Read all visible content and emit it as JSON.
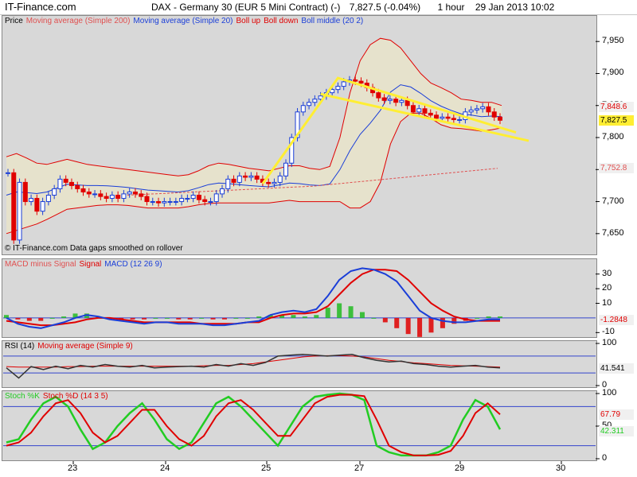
{
  "header": {
    "brand": "IT-Finance.com",
    "instrument": "DAX - Germany 30 (EUR 5 Mini Contract) (-)",
    "last": "7,827.5 (-0.04%)",
    "timeframe": "1 hour",
    "datetime": "29 Jan 2013 10:02"
  },
  "colors": {
    "background": "#d8d8d8",
    "ma200": "#e05050",
    "ma20": "#1a3ed8",
    "boll": "#e00000",
    "bollFill": "#e6e2cc",
    "bullCandle": "#1a3ed8",
    "bearCandle": "#e00000",
    "trendline": "#ffee33",
    "macdLine": "#1a3ed8",
    "signalLine": "#e00000",
    "histPos": "#22bb22",
    "histNeg": "#e00000",
    "rsi": "#333333",
    "rsiMa": "#e00000",
    "stochK": "#22cc22",
    "stochD": "#e00000"
  },
  "footnote": "© IT-Finance.com  Data gaps smoothed on rollover",
  "chart_data": [
    {
      "type": "candlestick",
      "panel": "price",
      "legend": [
        {
          "text": "Price",
          "color": "#000000"
        },
        {
          "text": "Moving average (Simple 200)",
          "color": "#e05050"
        },
        {
          "text": "Moving average (Simple 20)",
          "color": "#1a3ed8"
        },
        {
          "text": "Boll up",
          "color": "#e00000"
        },
        {
          "text": "Boll down",
          "color": "#e00000"
        },
        {
          "text": "Boll middle (20 2)",
          "color": "#1a3ed8"
        }
      ],
      "ylim": [
        7620,
        7985
      ],
      "yticks": [
        "7,650",
        "7,700",
        "7,750",
        "7,800",
        "7,850",
        "7,900",
        "7,950"
      ],
      "ytick_values": [
        7650,
        7700,
        7750,
        7800,
        7850,
        7900,
        7950
      ],
      "tags": [
        {
          "text": "7,848.6",
          "value": 7848.6,
          "bg": "#f0f0f0",
          "color": "#e00000"
        },
        {
          "text": "7,827.5",
          "value": 7827.5,
          "bg": "#ffee33",
          "color": "#000000"
        },
        {
          "text": "7,752.8",
          "value": 7752.8,
          "bg": "#f0f0f0",
          "color": "#e05050"
        }
      ],
      "x_day_labels": [
        "23",
        "24",
        "25",
        "27",
        "29",
        "30"
      ],
      "price": [
        7745,
        7640,
        7730,
        7700,
        7705,
        7685,
        7700,
        7710,
        7720,
        7735,
        7730,
        7725,
        7720,
        7715,
        7712,
        7712,
        7708,
        7705,
        7710,
        7705,
        7712,
        7715,
        7712,
        7708,
        7700,
        7700,
        7698,
        7700,
        7700,
        7700,
        7705,
        7705,
        7710,
        7703,
        7700,
        7700,
        7712,
        7720,
        7735,
        7730,
        7740,
        7738,
        7740,
        7735,
        7730,
        7728,
        7730,
        7740,
        7760,
        7800,
        7840,
        7850,
        7855,
        7860,
        7865,
        7870,
        7875,
        7880,
        7887,
        7890,
        7888,
        7885,
        7878,
        7870,
        7862,
        7858,
        7860,
        7855,
        7858,
        7850,
        7840,
        7845,
        7838,
        7835,
        7830,
        7832,
        7830,
        7828,
        7828,
        7840,
        7843,
        7845,
        7848,
        7840,
        7832,
        7827
      ],
      "ma200": [
        7710,
        7711,
        7712,
        7713,
        7714,
        7715,
        7716,
        7717,
        7718,
        7719,
        7720,
        7721,
        7722,
        7723,
        7724,
        7726,
        7728,
        7730,
        7732,
        7734,
        7736,
        7738,
        7740,
        7742,
        7744,
        7746,
        7748,
        7750,
        7752
      ],
      "boll_up": [
        7770,
        7775,
        7768,
        7760,
        7758,
        7762,
        7766,
        7762,
        7758,
        7756,
        7754,
        7752,
        7750,
        7748,
        7746,
        7744,
        7742,
        7740,
        7742,
        7748,
        7756,
        7760,
        7758,
        7755,
        7752,
        7750,
        7748,
        7752,
        7756,
        7756,
        7752,
        7750,
        7755,
        7800,
        7870,
        7920,
        7945,
        7955,
        7952,
        7940,
        7920,
        7900,
        7885,
        7878,
        7870,
        7860,
        7858,
        7855,
        7855,
        7850
      ],
      "boll_down": [
        7650,
        7655,
        7660,
        7665,
        7672,
        7680,
        7688,
        7690,
        7692,
        7694,
        7695,
        7695,
        7694,
        7692,
        7690,
        7690,
        7690,
        7690,
        7692,
        7695,
        7697,
        7698,
        7698,
        7698,
        7698,
        7698,
        7698,
        7700,
        7702,
        7700,
        7700,
        7700,
        7700,
        7700,
        7690,
        7690,
        7700,
        7730,
        7790,
        7825,
        7838,
        7838,
        7830,
        7820,
        7815,
        7814,
        7812,
        7810,
        7812,
        7815
      ]
    },
    {
      "type": "histogram+line",
      "panel": "macd",
      "legend": [
        {
          "text": "MACD minus Signal",
          "color": "#e05050"
        },
        {
          "text": "Signal",
          "color": "#e00000"
        },
        {
          "text": "MACD (12 26 9)",
          "color": "#1a3ed8"
        }
      ],
      "ylim": [
        -12,
        38
      ],
      "yticks": [
        "30",
        "20",
        "10",
        "-10"
      ],
      "ytick_values": [
        30,
        20,
        10,
        -10
      ],
      "tags": [
        {
          "text": "-1.2848",
          "value": -1.2848,
          "bg": "#f0f0f0",
          "color": "#e00000"
        }
      ],
      "macd": [
        0,
        -4,
        -6,
        -7,
        -5,
        -3,
        0,
        2,
        1,
        -1,
        -2,
        -3,
        -4,
        -3,
        -3,
        -4,
        -4,
        -4,
        -5,
        -5,
        -4,
        -3,
        -2,
        2,
        4,
        5,
        4,
        6,
        15,
        26,
        32,
        34,
        33,
        30,
        25,
        15,
        5,
        0,
        -2,
        -3,
        -3,
        -2,
        -1,
        -1
      ],
      "signal": [
        -2,
        -3,
        -4,
        -5,
        -5,
        -4,
        -3,
        -1,
        0,
        0,
        -1,
        -2,
        -3,
        -3,
        -3,
        -3,
        -3,
        -4,
        -4,
        -4,
        -4,
        -3,
        -3,
        0,
        2,
        3,
        3,
        4,
        8,
        16,
        24,
        30,
        33,
        33,
        32,
        26,
        18,
        10,
        5,
        1,
        -1,
        -2,
        -2,
        -2
      ],
      "hist": [
        2,
        -1,
        -2,
        -2,
        0,
        1,
        3,
        3,
        1,
        -1,
        -1,
        -1,
        -1,
        0,
        0,
        -1,
        -1,
        0,
        -1,
        -1,
        0,
        0,
        1,
        2,
        2,
        2,
        1,
        2,
        7,
        10,
        8,
        4,
        0,
        -3,
        -7,
        -11,
        -13,
        -10,
        -7,
        -4,
        -2,
        0,
        1,
        1
      ]
    },
    {
      "type": "line",
      "panel": "rsi",
      "legend": [
        {
          "text": "RSI (14)",
          "color": "#000000"
        },
        {
          "text": "Moving average (Simple 9)",
          "color": "#e00000"
        }
      ],
      "ylim": [
        0,
        100
      ],
      "yticks": [
        "100",
        "0"
      ],
      "ytick_values": [
        100,
        0
      ],
      "tags": [
        {
          "text": "41.541",
          "value": 41.541,
          "bg": "#f0f0f0",
          "color": "#000000"
        }
      ],
      "rsi": [
        42,
        18,
        45,
        38,
        46,
        40,
        48,
        44,
        50,
        46,
        44,
        48,
        42,
        44,
        45,
        46,
        44,
        50,
        46,
        52,
        48,
        55,
        70,
        72,
        74,
        72,
        70,
        72,
        74,
        66,
        60,
        56,
        58,
        52,
        50,
        46,
        44,
        46,
        48,
        44,
        42
      ],
      "rsi_ma": [
        45,
        44,
        44,
        44,
        44,
        45,
        45,
        46,
        46,
        46,
        46,
        46,
        46,
        46,
        46,
        46,
        47,
        48,
        48,
        50,
        52,
        56,
        60,
        64,
        68,
        70,
        71,
        71,
        70,
        68,
        64,
        60,
        57,
        54,
        52,
        50,
        48,
        47,
        46,
        45,
        44
      ]
    },
    {
      "type": "line",
      "panel": "stochastic",
      "legend": [
        {
          "text": "Stoch %K",
          "color": "#22cc22"
        },
        {
          "text": "Stoch %D (14 3 5)",
          "color": "#e00000"
        }
      ],
      "ylim": [
        0,
        100
      ],
      "yticks": [
        "100",
        "50",
        "0"
      ],
      "ytick_values": [
        100,
        50,
        0
      ],
      "tags": [
        {
          "text": "67.79",
          "value": 67.79,
          "bg": "#f0f0f0",
          "color": "#e00000"
        },
        {
          "text": "42.311",
          "value": 42.311,
          "bg": "#f0f0f0",
          "color": "#22cc22"
        }
      ],
      "stoch_k": [
        25,
        30,
        60,
        85,
        95,
        80,
        45,
        15,
        25,
        50,
        70,
        85,
        60,
        30,
        15,
        25,
        55,
        85,
        95,
        80,
        60,
        40,
        20,
        50,
        80,
        95,
        98,
        100,
        98,
        90,
        20,
        10,
        5,
        5,
        5,
        10,
        20,
        60,
        90,
        80,
        45
      ],
      "stoch_d": [
        20,
        25,
        40,
        65,
        85,
        90,
        70,
        40,
        25,
        35,
        55,
        75,
        75,
        50,
        30,
        20,
        35,
        65,
        85,
        90,
        75,
        55,
        35,
        35,
        60,
        85,
        95,
        98,
        98,
        96,
        60,
        20,
        10,
        5,
        5,
        6,
        12,
        35,
        70,
        85,
        68
      ]
    }
  ]
}
